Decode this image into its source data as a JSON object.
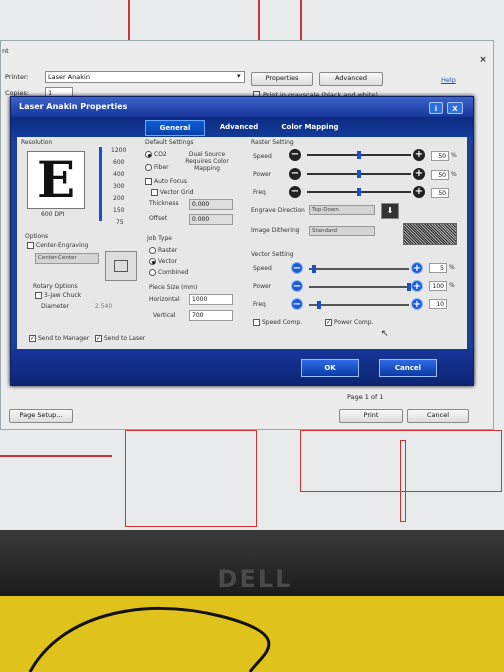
{
  "print_dialog": {
    "title_fragment": "nt",
    "printer_label": "Printer:",
    "printer_value": "Laser Anakin",
    "copies_label": "Copies:",
    "copies_value": "1",
    "properties_label": "Properties",
    "advanced_label": "Advanced",
    "help_label": "Help",
    "grayscale_label": "Print in grayscale (black and white)",
    "page_setup_label": "Page Setup...",
    "page_indicator": "Page 1 of 1",
    "print_label": "Print",
    "cancel_label": "Cancel"
  },
  "props": {
    "title": "Laser Anakin Properties",
    "help_icon": "i",
    "close_icon": "X",
    "tabs": [
      {
        "label": "General",
        "active": true
      },
      {
        "label": "Advanced",
        "active": false
      },
      {
        "label": "Color Mapping",
        "active": false
      }
    ],
    "resolution": {
      "label": "Resolution",
      "letter": "E",
      "dpi_caption": "600 DPI",
      "scale": [
        "1200",
        "600",
        "400",
        "300",
        "200",
        "150",
        "75"
      ]
    },
    "options": {
      "label": "Options",
      "center_engraving": "Center-Engraving",
      "center_dropdown": "Center-Center",
      "rotary_label": "Rotary Options",
      "jaw_chuck": "3-Jaw Chuck",
      "diameter_label": "Diameter",
      "diameter_value": "2.540"
    },
    "send_to_manager": "Send to Manager",
    "send_to_laser": "Send to Laser",
    "defaults": {
      "label": "Default Settings",
      "co2": "CO2",
      "fiber": "Fiber",
      "dual_source": "Dual Source Requires Color Mapping",
      "auto_focus": "Auto Focus",
      "vector_grid": "Vector Grid",
      "thickness_label": "Thickness",
      "thickness_value": "0.000",
      "offset_label": "Offset",
      "offset_value": "0.000"
    },
    "job_type": {
      "label": "Job Type",
      "raster": "Raster",
      "vector": "Vector",
      "combined": "Combined",
      "selected": "Vector"
    },
    "piece_size": {
      "label": "Piece Size (mm)",
      "horizontal_label": "Horizontal",
      "horizontal_value": "1000",
      "vertical_label": "Vertical",
      "vertical_value": "700"
    },
    "raster": {
      "label": "Raster Setting",
      "speed_label": "Speed",
      "speed_value": "50",
      "speed_level": 0.5,
      "power_label": "Power",
      "power_value": "50",
      "power_level": 0.5,
      "freq_label": "Freq",
      "freq_value": "50",
      "freq_level": 0.5,
      "unit": "%",
      "engrave_dir_label": "Engrave Direction",
      "engrave_dir_value": "Top-Down",
      "dithering_label": "Image Dithering",
      "dithering_value": "Standard"
    },
    "vector": {
      "label": "Vector Setting",
      "speed_label": "Speed",
      "speed_value": "5",
      "speed_level": 0.05,
      "power_label": "Power",
      "power_value": "100",
      "power_level": 1.0,
      "freq_label": "Freq",
      "freq_value": "10",
      "freq_level": 0.1,
      "unit": "%",
      "speed_comp": "Speed Comp.",
      "power_comp": "Power Comp."
    },
    "ok_label": "OK",
    "cancel_label": "Cancel"
  },
  "monitor_brand": "DELL"
}
